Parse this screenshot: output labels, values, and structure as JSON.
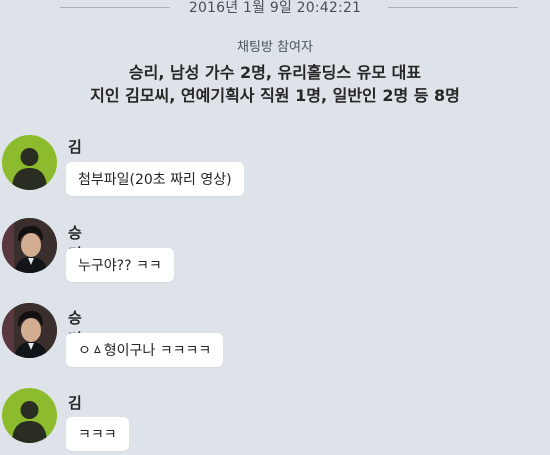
{
  "date_separator": "2016년 1월 9일 20:42:21",
  "participants": {
    "header": "채팅방 참여자",
    "line1": "승리, 남성 가수 2명, 유리홀딩스 유모 대표",
    "line2": "지인 김모씨, 연예기획사 직원 1명, 일반인 2명 등 8명"
  },
  "messages": [
    {
      "sender": "김ㅿㅿ",
      "text": "첨부파일(20초 짜리 영상)",
      "avatar": "default-person-icon"
    },
    {
      "sender": "승리",
      "text": "누구야?? ㅋㅋ",
      "avatar": "profile-photo"
    },
    {
      "sender": "승리",
      "text": "ㅇㅿ형이구나 ㅋㅋㅋㅋ",
      "avatar": "profile-photo"
    },
    {
      "sender": "김ㅿㅿ",
      "text": "ㅋㅋㅋ",
      "avatar": "default-person-icon"
    }
  ],
  "colors": {
    "background": "#dde3e8",
    "bubble": "#ffffff",
    "default_avatar": "#8cbc2e"
  }
}
